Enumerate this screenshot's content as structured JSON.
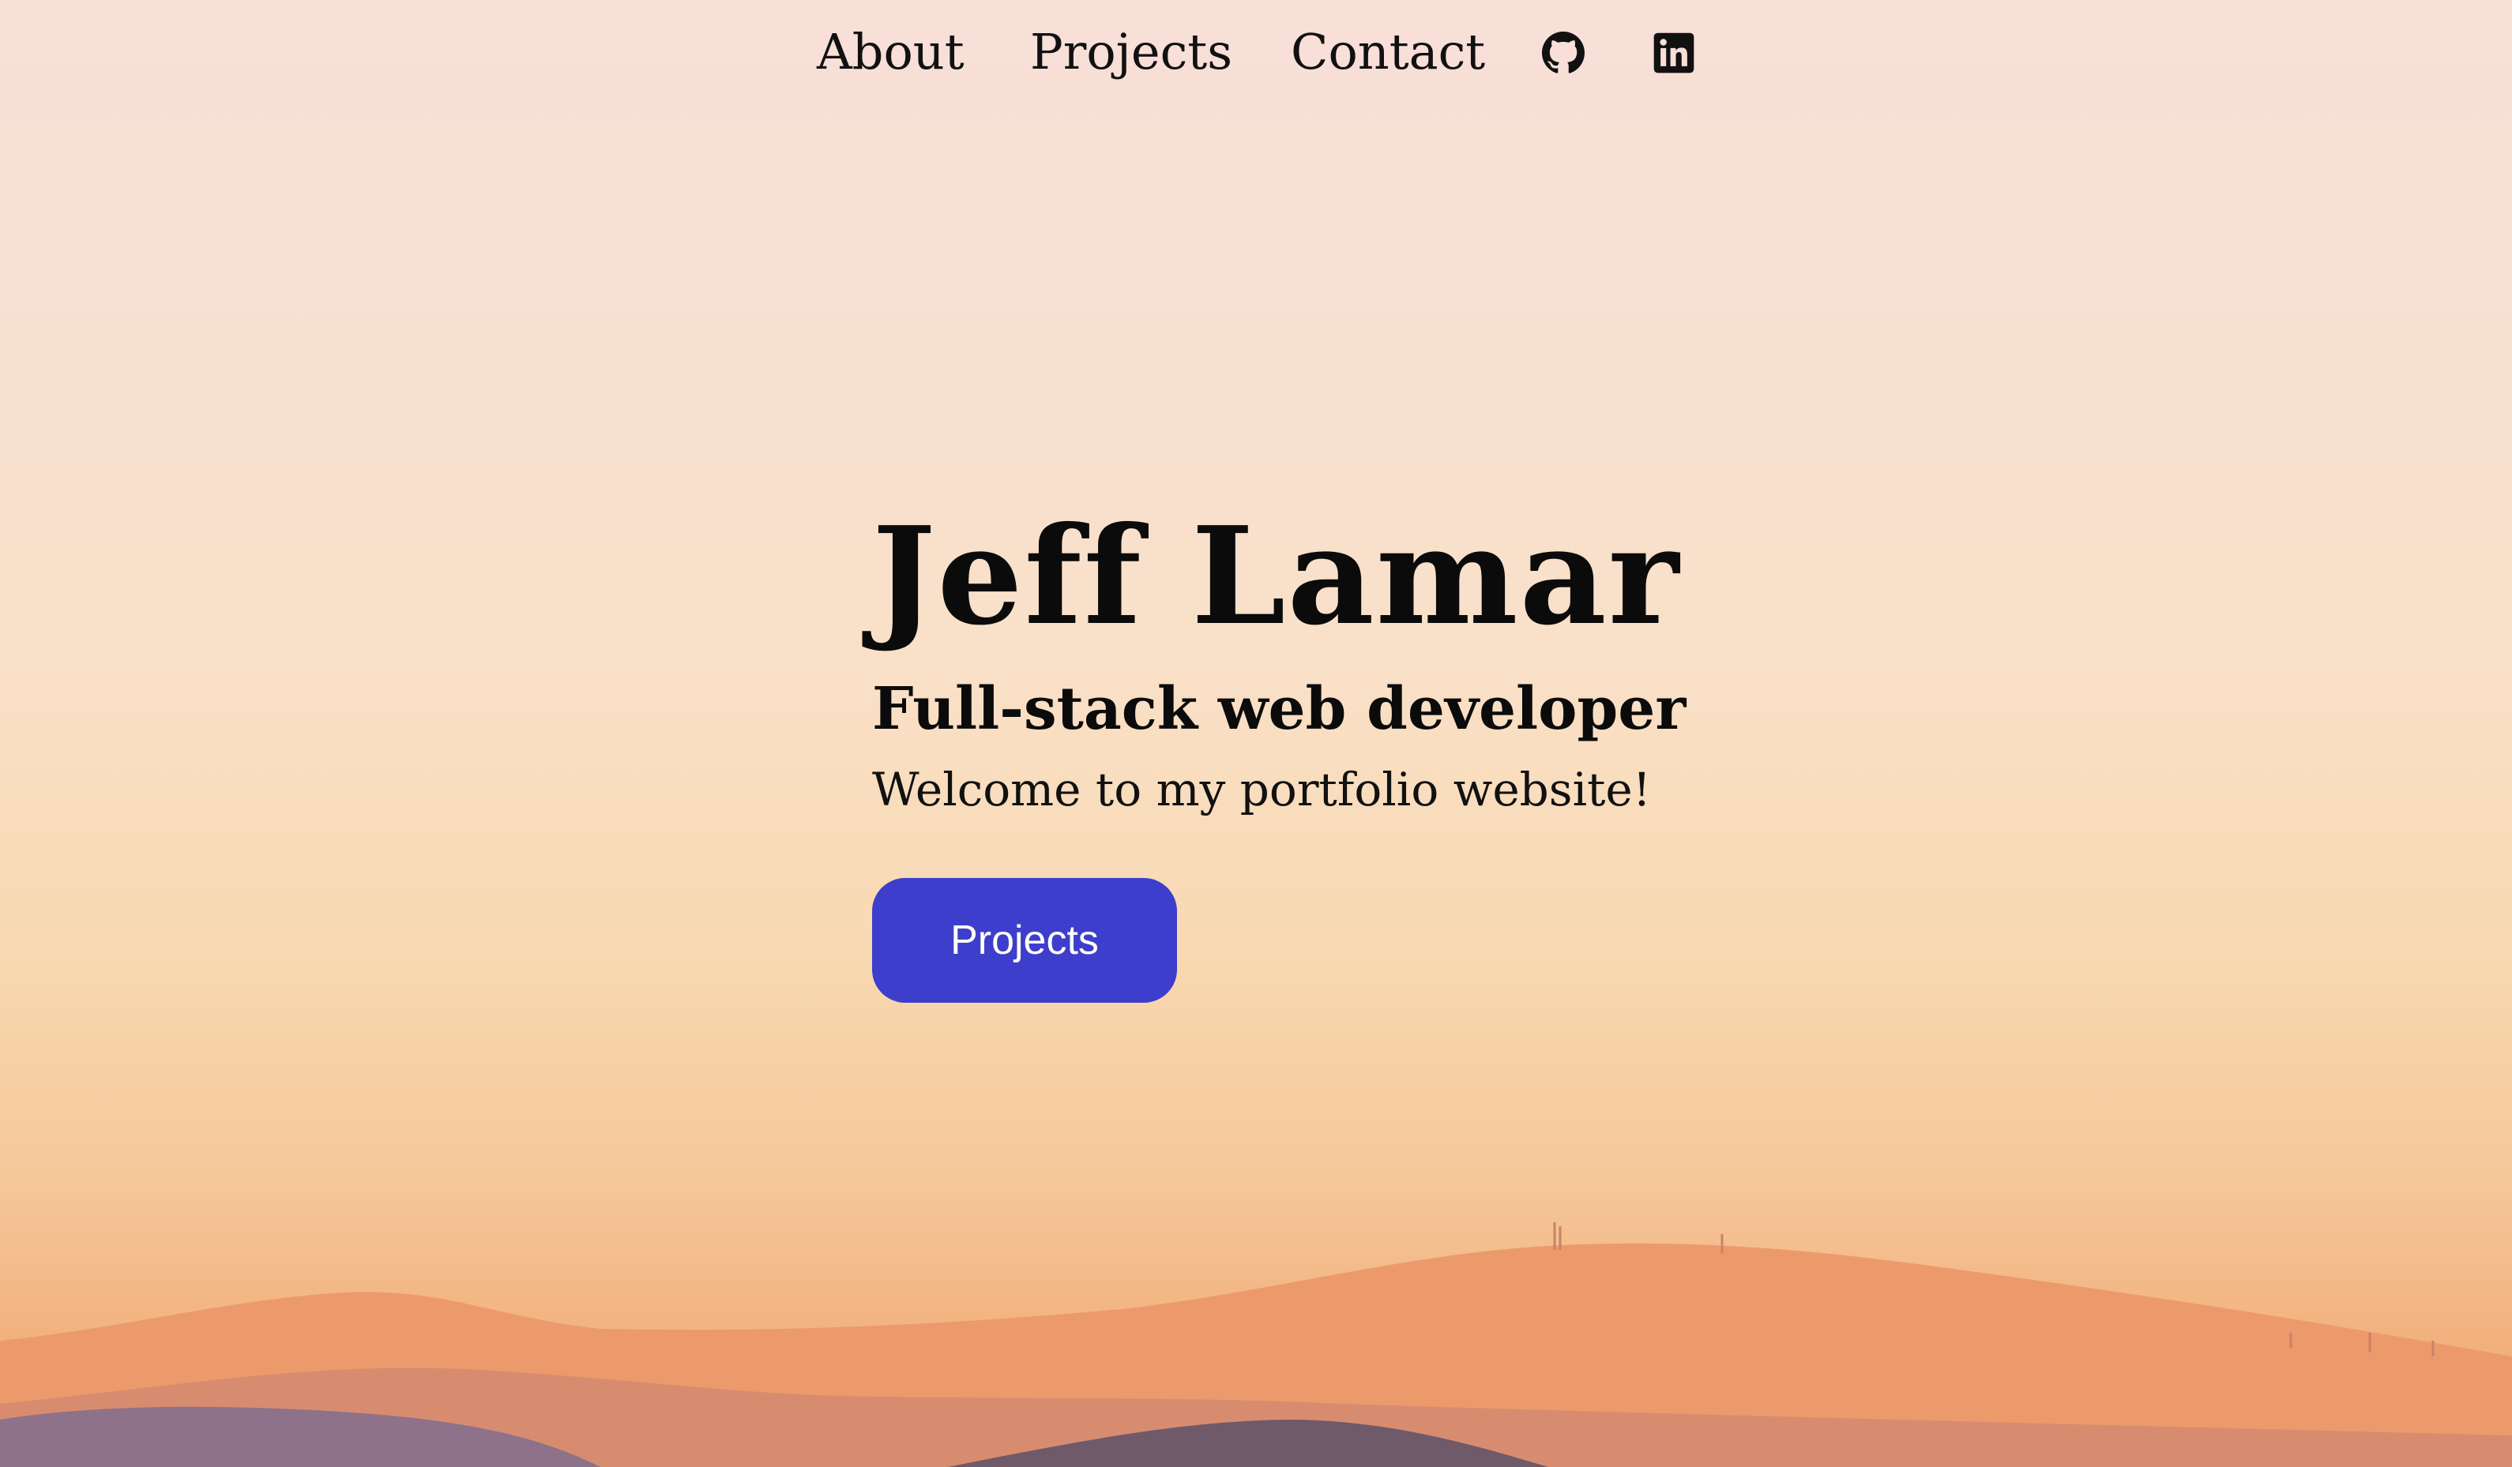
{
  "nav": {
    "links": [
      {
        "label": "About"
      },
      {
        "label": "Projects"
      },
      {
        "label": "Contact"
      }
    ],
    "icons": [
      "github-icon",
      "linkedin-icon"
    ]
  },
  "hero": {
    "name": "Jeff Lamar",
    "role": "Full-stack web developer",
    "welcome": "Welcome to my portfolio website!",
    "button_label": "Projects"
  },
  "colors": {
    "accent": "#3e3ecc",
    "text": "#0b0b0b",
    "sky_top": "#f8dfd8",
    "sky_bottom": "#ec9a6a"
  }
}
